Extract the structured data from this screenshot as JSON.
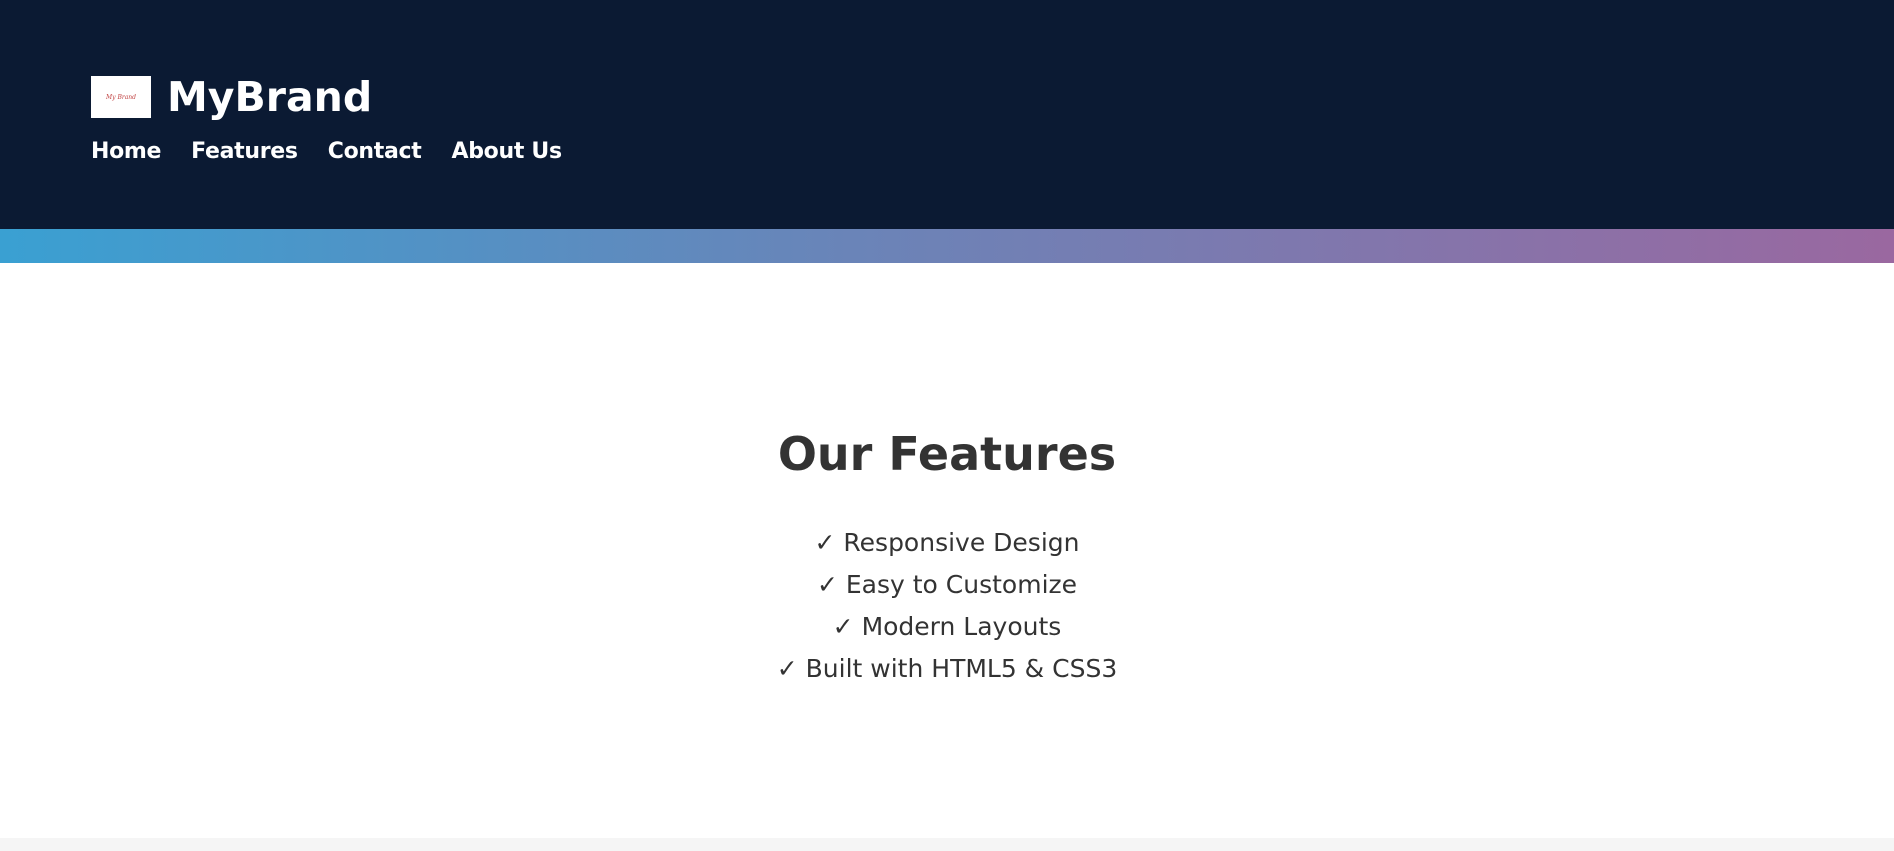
{
  "header": {
    "logo_text": "My Brand",
    "brand_name": "MyBrand",
    "nav": [
      {
        "label": "Home"
      },
      {
        "label": "Features"
      },
      {
        "label": "Contact"
      },
      {
        "label": "About Us"
      }
    ]
  },
  "features": {
    "title": "Our Features",
    "items": [
      "✓ Responsive Design",
      "✓ Easy to Customize",
      "✓ Modern Layouts",
      "✓ Built with HTML5 & CSS3"
    ]
  },
  "colors": {
    "header_bg": "#0b1a33",
    "gradient_start": "#3aa0d2",
    "gradient_end": "#9a68a0",
    "text": "#333333"
  }
}
